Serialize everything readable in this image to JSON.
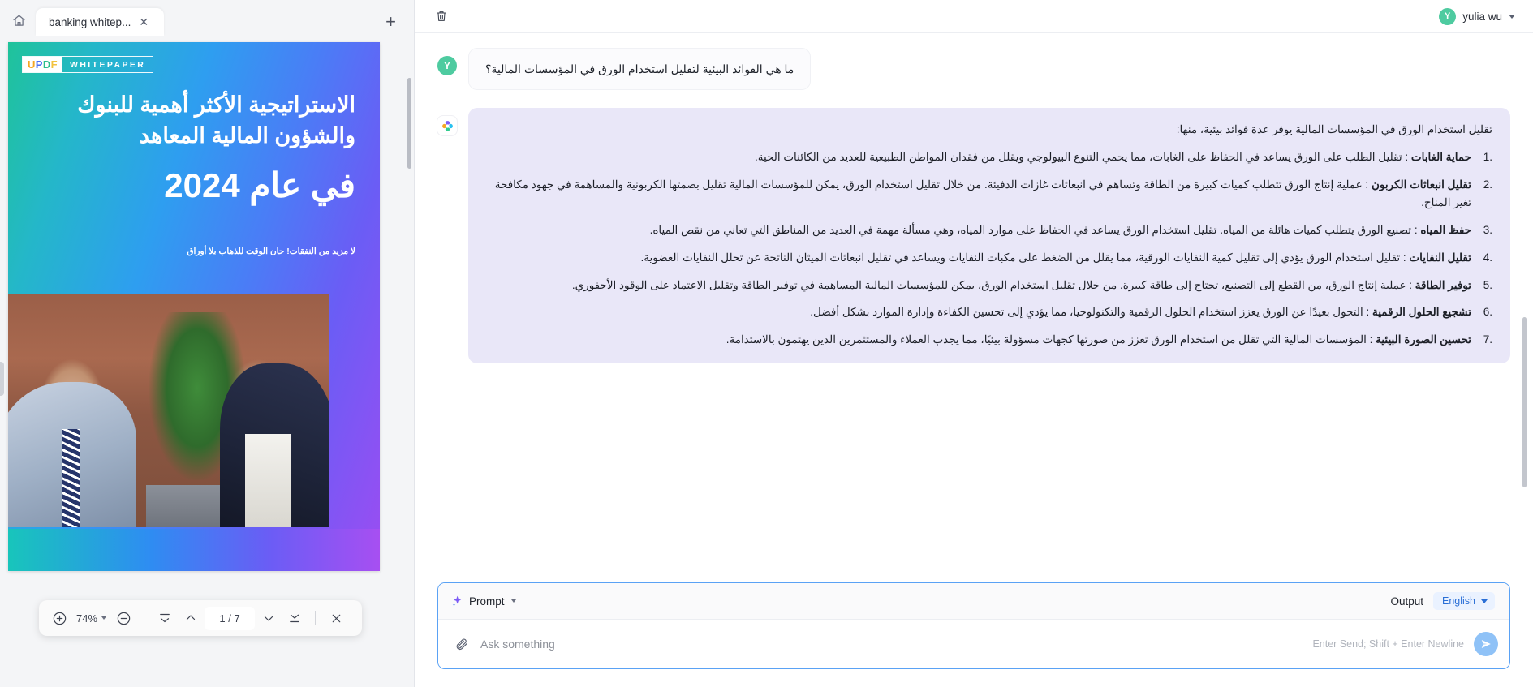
{
  "left_pane": {
    "home_icon": "home-icon",
    "tab": {
      "label": "banking whitep...",
      "close_icon": "close-icon"
    },
    "new_tab_label": "+",
    "document": {
      "brand_mark": {
        "u": "U",
        "p": "P",
        "d": "D",
        "f": "F"
      },
      "brand_word": "WHITEPAPER",
      "title": "الاستراتيجية الأكثر أهمية للبنوك والشؤون المالية المعاهد",
      "year_line": "في عام 2024",
      "subtitle": "لا مزيد من النفقات! حان الوقت للذهاب بلا أوراق"
    },
    "toolbar": {
      "zoom_in_icon": "plus-circle-icon",
      "zoom_value": "74%",
      "zoom_out_icon": "minus-circle-icon",
      "first_page_icon": "first-page-icon",
      "prev_page_icon": "prev-page-icon",
      "page_indicator": "1 / 7",
      "next_page_icon": "next-page-icon",
      "last_page_icon": "last-page-icon",
      "close_icon": "close-icon"
    }
  },
  "right_pane": {
    "header": {
      "delete_icon": "trash-icon",
      "user_name": "yulia wu",
      "user_initial": "Y",
      "chevron_icon": "chevron-down-icon"
    },
    "conversation": [
      {
        "role": "user",
        "initial": "Y",
        "text": "ما هي الفوائد البيئية لتقليل استخدام الورق في المؤسسات المالية؟"
      }
    ],
    "answer": {
      "avatar_icon": "ai-logo-icon",
      "intro": "تقليل استخدام الورق في المؤسسات المالية يوفر عدة فوائد بيئية، منها:",
      "items": [
        {
          "heading": "حماية الغابات",
          "body": "تقليل الطلب على الورق يساعد في الحفاظ على الغابات، مما يحمي التنوع البيولوجي ويقلل من فقدان المواطن الطبيعية للعديد من الكائنات الحية."
        },
        {
          "heading": "تقليل انبعاثات الكربون",
          "body": "عملية إنتاج الورق تتطلب كميات كبيرة من الطاقة وتساهم في انبعاثات غازات الدفيئة. من خلال تقليل استخدام الورق، يمكن للمؤسسات المالية تقليل بصمتها الكربونية والمساهمة في جهود مكافحة تغير المناخ."
        },
        {
          "heading": "حفظ المياه",
          "body": "تصنيع الورق يتطلب كميات هائلة من المياه. تقليل استخدام الورق يساعد في الحفاظ على موارد المياه، وهي مسألة مهمة في العديد من المناطق التي تعاني من نقص المياه."
        },
        {
          "heading": "تقليل النفايات",
          "body": "تقليل استخدام الورق يؤدي إلى تقليل كمية النفايات الورقية، مما يقلل من الضغط على مكبات النفايات ويساعد في تقليل انبعاثات الميثان الناتجة عن تحلل النفايات العضوية."
        },
        {
          "heading": "توفير الطاقة",
          "body": "عملية إنتاج الورق، من القطع إلى التصنيع، تحتاج إلى طاقة كبيرة. من خلال تقليل استخدام الورق، يمكن للمؤسسات المالية المساهمة في توفير الطاقة وتقليل الاعتماد على الوقود الأحفوري."
        },
        {
          "heading": "تشجيع الحلول الرقمية",
          "body": "التحول بعيدًا عن الورق يعزز استخدام الحلول الرقمية والتكنولوجيا، مما يؤدي إلى تحسين الكفاءة وإدارة الموارد بشكل أفضل."
        },
        {
          "heading": "تحسين الصورة البيئية",
          "body": "المؤسسات المالية التي تقلل من استخدام الورق تعزز من صورتها كجهات مسؤولة بيئيًا، مما يجذب العملاء والمستثمرين الذين يهتمون بالاستدامة."
        }
      ]
    },
    "composer": {
      "prompt_label": "Prompt",
      "prompt_icon": "sparkle-icon",
      "prompt_caret_icon": "chevron-down-icon",
      "output_label": "Output",
      "language_value": "English",
      "language_caret_icon": "chevron-down-icon",
      "attach_icon": "paperclip-icon",
      "input_placeholder": "Ask something",
      "input_value": "",
      "hint": "Enter Send; Shift + Enter Newline",
      "send_icon": "send-icon"
    }
  },
  "colors": {
    "accent_blue": "#5aa2f5",
    "ai_bubble": "#e9e7f8",
    "avatar_green": "#4ecba0",
    "lang_pill_bg": "#eaf2ff",
    "lang_pill_text": "#2a6fd6"
  }
}
